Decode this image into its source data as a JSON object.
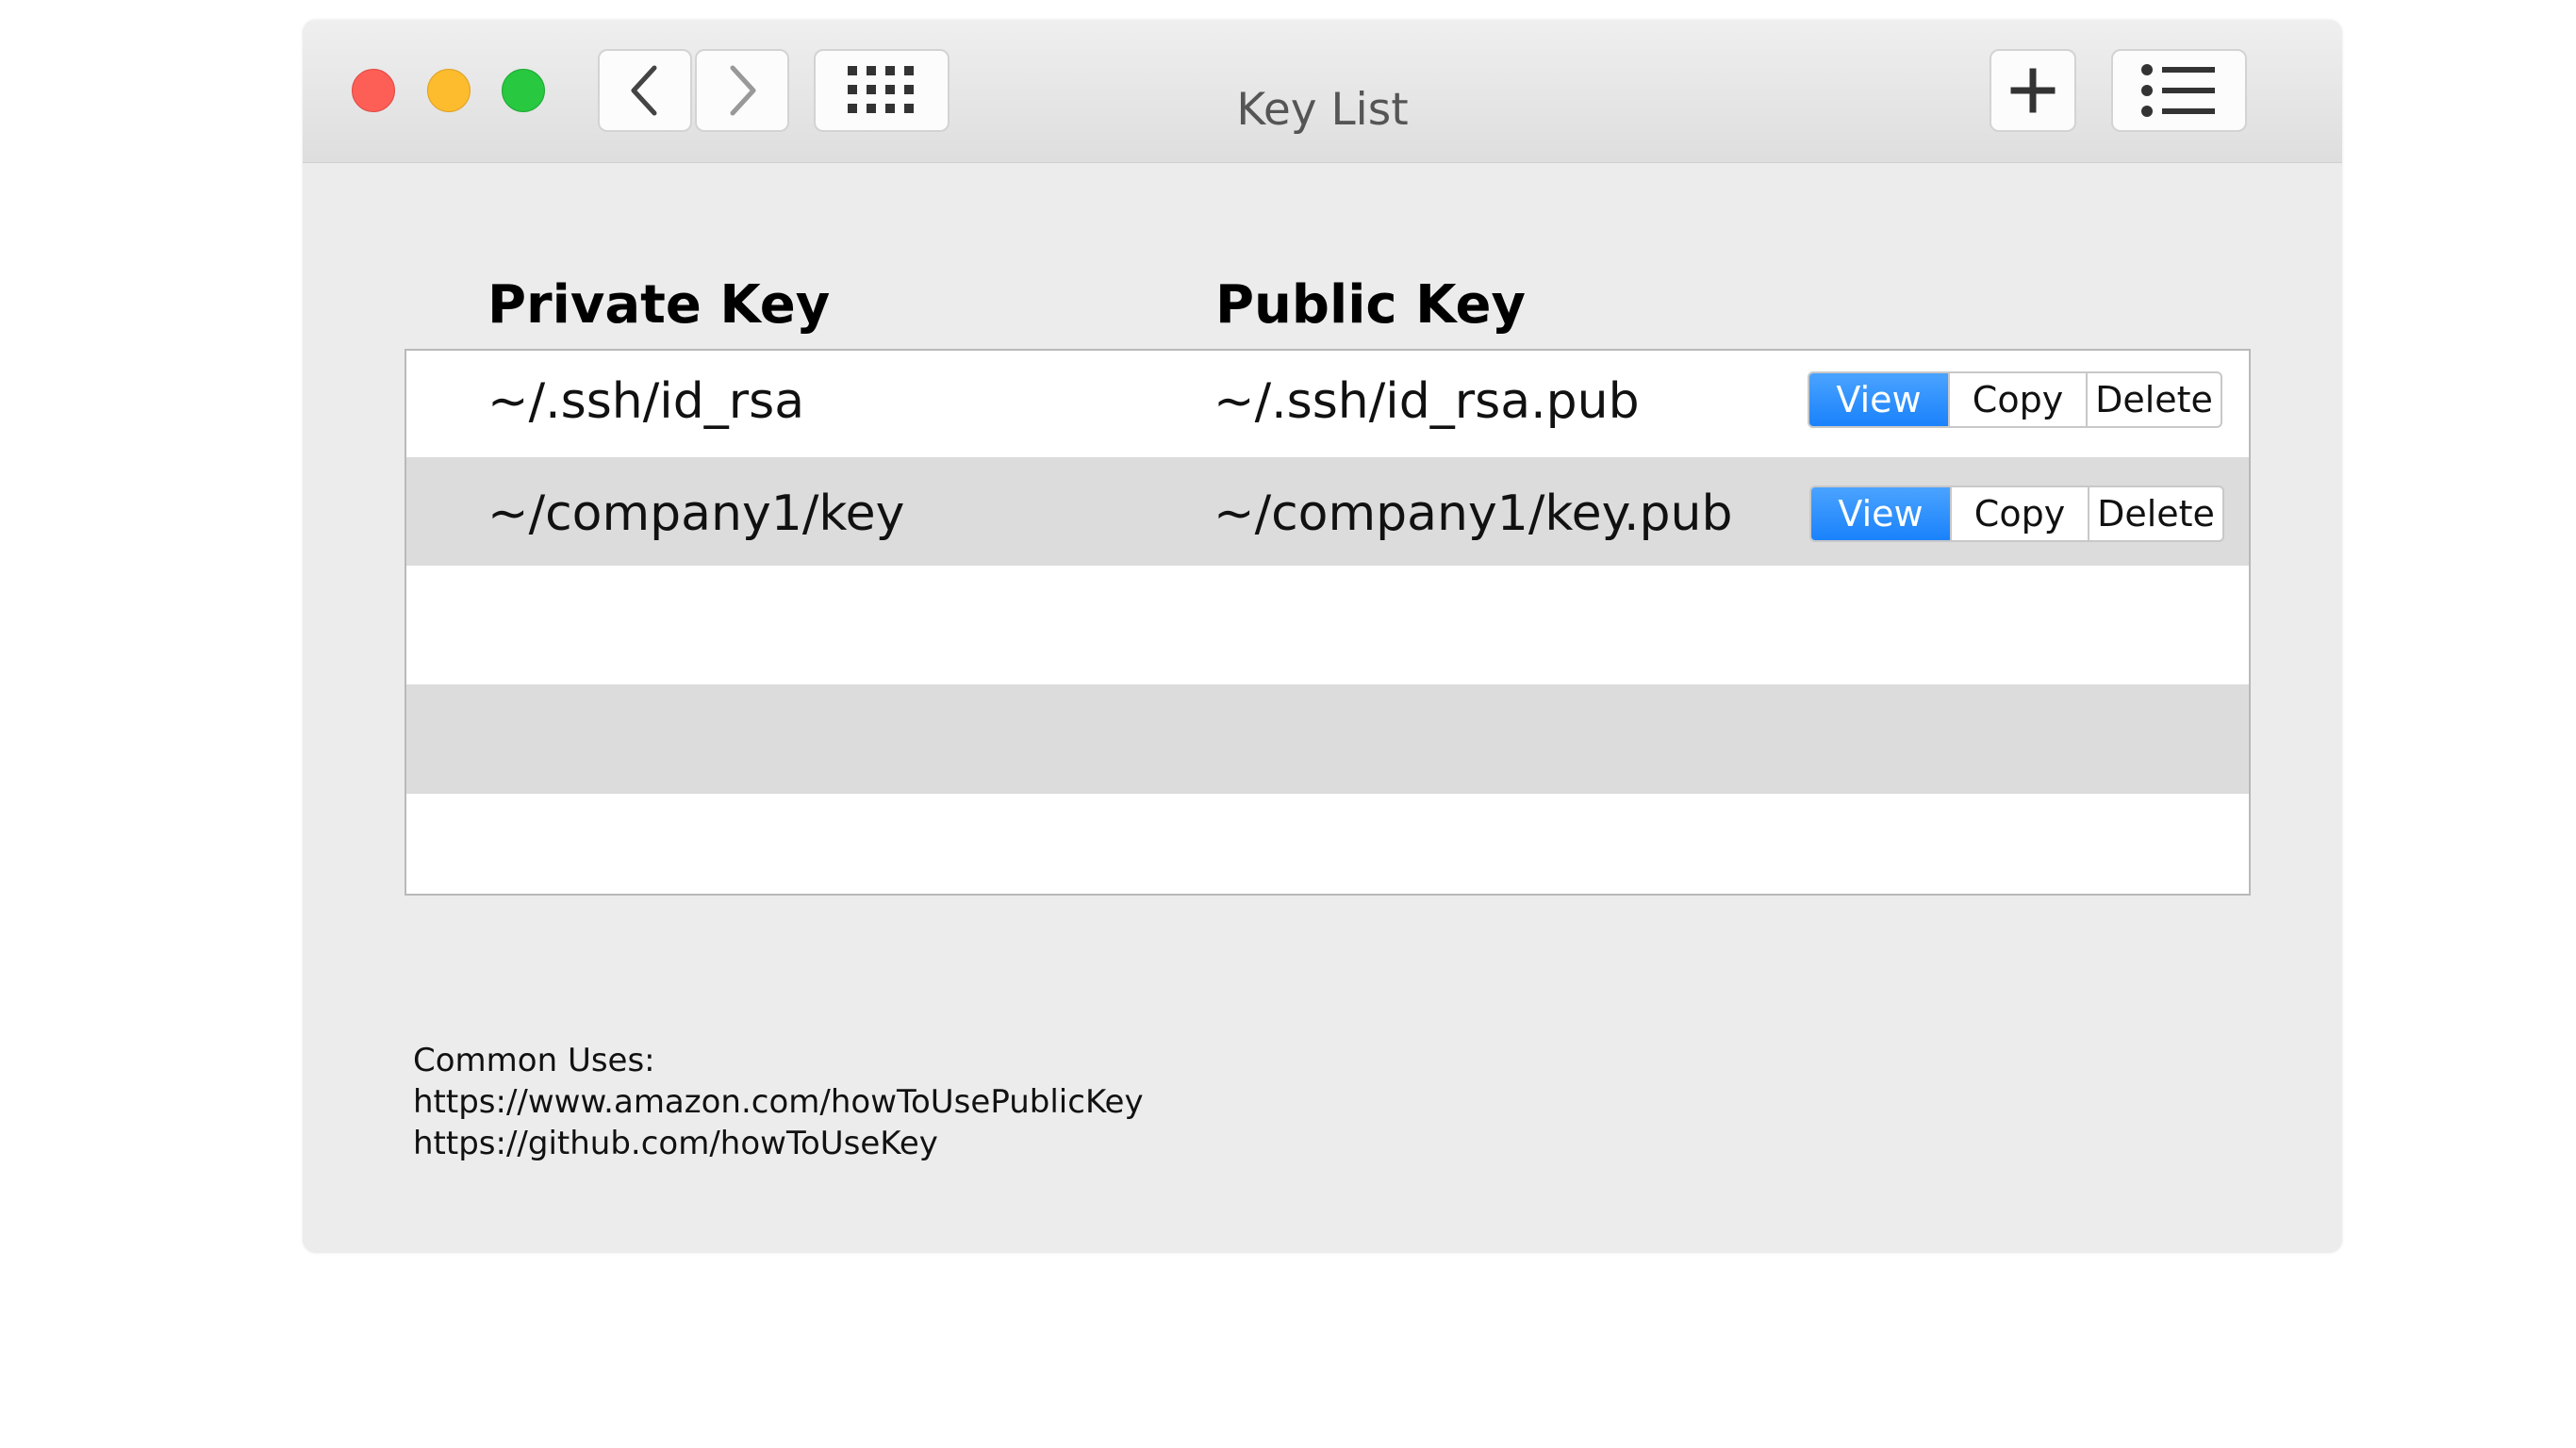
{
  "window": {
    "title": "Key List"
  },
  "toolbar": {
    "back_icon": "chevron-left-icon",
    "forward_icon": "chevron-right-icon",
    "grid_icon": "grid-icon",
    "add_icon": "plus-icon",
    "list_icon": "list-icon"
  },
  "table": {
    "headers": {
      "private": "Private Key",
      "public": "Public Key"
    },
    "rows": [
      {
        "private": "~/.ssh/id_rsa",
        "public": "~/.ssh/id_rsa.pub",
        "actions": {
          "view": "View",
          "copy": "Copy",
          "delete": "Delete"
        }
      },
      {
        "private": "~/company1/key",
        "public": "~/company1/key.pub",
        "actions": {
          "view": "View",
          "copy": "Copy",
          "delete": "Delete"
        }
      }
    ]
  },
  "footer": {
    "heading": "Common Uses:",
    "links": [
      "https://www.amazon.com/howToUsePublicKey",
      "https://github.com/howToUseKey"
    ]
  },
  "colors": {
    "close": "#fd5f57",
    "minimize": "#fdbc2e",
    "zoom": "#28c840",
    "accent": "#1a82fb",
    "alt_row": "#dcdcdc",
    "window_bg": "#ececec"
  }
}
